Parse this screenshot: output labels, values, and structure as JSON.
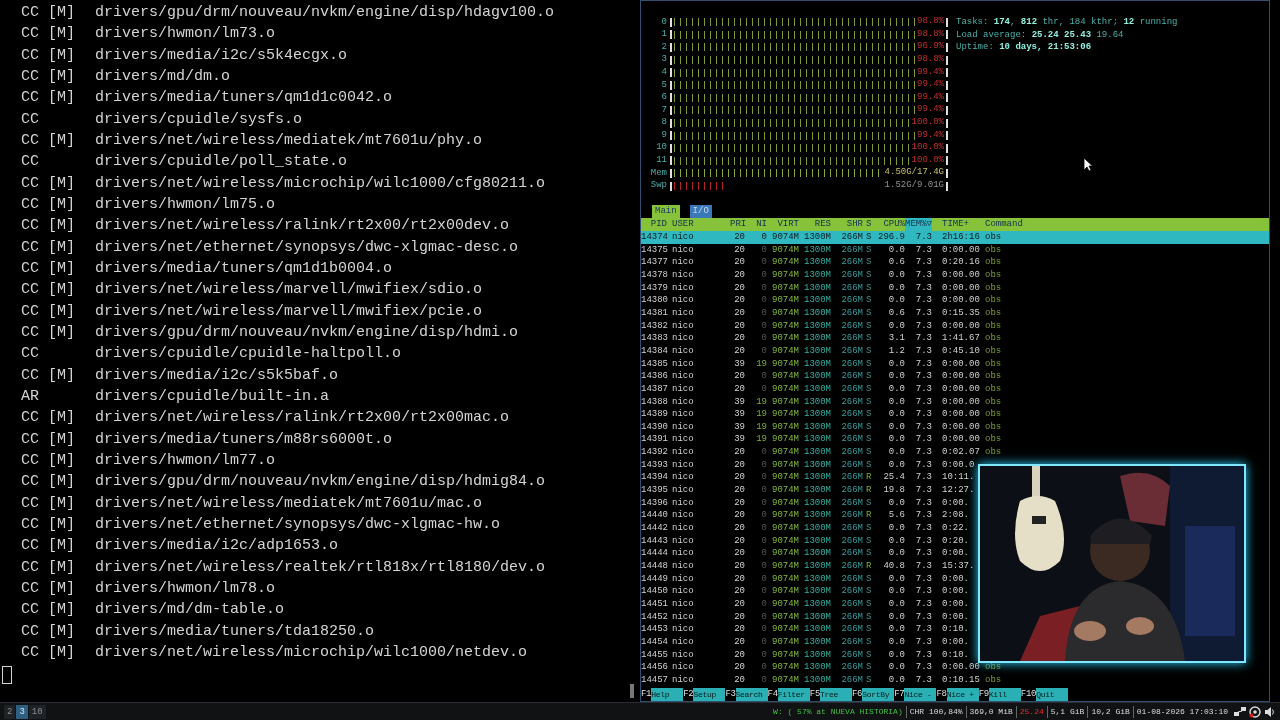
{
  "terminal": {
    "lines": [
      {
        "tag": "CC [M]",
        "path": "drivers/gpu/drm/nouveau/nvkm/engine/disp/hdagv100.o"
      },
      {
        "tag": "CC [M]",
        "path": "drivers/hwmon/lm73.o"
      },
      {
        "tag": "CC [M]",
        "path": "drivers/media/i2c/s5k4ecgx.o"
      },
      {
        "tag": "CC [M]",
        "path": "drivers/md/dm.o"
      },
      {
        "tag": "CC [M]",
        "path": "drivers/media/tuners/qm1d1c0042.o"
      },
      {
        "tag": "CC",
        "path": "drivers/cpuidle/sysfs.o"
      },
      {
        "tag": "CC [M]",
        "path": "drivers/net/wireless/mediatek/mt7601u/phy.o"
      },
      {
        "tag": "CC",
        "path": "drivers/cpuidle/poll_state.o"
      },
      {
        "tag": "CC [M]",
        "path": "drivers/net/wireless/microchip/wilc1000/cfg80211.o"
      },
      {
        "tag": "CC [M]",
        "path": "drivers/hwmon/lm75.o"
      },
      {
        "tag": "CC [M]",
        "path": "drivers/net/wireless/ralink/rt2x00/rt2x00dev.o"
      },
      {
        "tag": "CC [M]",
        "path": "drivers/net/ethernet/synopsys/dwc-xlgmac-desc.o"
      },
      {
        "tag": "CC [M]",
        "path": "drivers/media/tuners/qm1d1b0004.o"
      },
      {
        "tag": "CC [M]",
        "path": "drivers/net/wireless/marvell/mwifiex/sdio.o"
      },
      {
        "tag": "CC [M]",
        "path": "drivers/net/wireless/marvell/mwifiex/pcie.o"
      },
      {
        "tag": "CC [M]",
        "path": "drivers/gpu/drm/nouveau/nvkm/engine/disp/hdmi.o"
      },
      {
        "tag": "CC",
        "path": "drivers/cpuidle/cpuidle-haltpoll.o"
      },
      {
        "tag": "CC [M]",
        "path": "drivers/media/i2c/s5k5baf.o"
      },
      {
        "tag": "AR",
        "path": "drivers/cpuidle/built-in.a"
      },
      {
        "tag": "CC [M]",
        "path": "drivers/net/wireless/ralink/rt2x00/rt2x00mac.o"
      },
      {
        "tag": "CC [M]",
        "path": "drivers/media/tuners/m88rs6000t.o"
      },
      {
        "tag": "CC [M]",
        "path": "drivers/hwmon/lm77.o"
      },
      {
        "tag": "CC [M]",
        "path": "drivers/gpu/drm/nouveau/nvkm/engine/disp/hdmig84.o"
      },
      {
        "tag": "CC [M]",
        "path": "drivers/net/wireless/mediatek/mt7601u/mac.o"
      },
      {
        "tag": "CC [M]",
        "path": "drivers/net/ethernet/synopsys/dwc-xlgmac-hw.o"
      },
      {
        "tag": "CC [M]",
        "path": "drivers/media/i2c/adp1653.o"
      },
      {
        "tag": "CC [M]",
        "path": "drivers/net/wireless/realtek/rtl818x/rtl8180/dev.o"
      },
      {
        "tag": "CC [M]",
        "path": "drivers/hwmon/lm78.o"
      },
      {
        "tag": "CC [M]",
        "path": "drivers/md/dm-table.o"
      },
      {
        "tag": "CC [M]",
        "path": "drivers/media/tuners/tda18250.o"
      },
      {
        "tag": "CC [M]",
        "path": "drivers/net/wireless/microchip/wilc1000/netdev.o"
      }
    ]
  },
  "htop": {
    "cpu_meters": [
      {
        "label": "0",
        "level": 0.988,
        "percent": "98.8%"
      },
      {
        "label": "1",
        "level": 0.988,
        "percent": "98.8%"
      },
      {
        "label": "2",
        "level": 0.969,
        "percent": "96.9%"
      },
      {
        "label": "3",
        "level": 0.988,
        "percent": "98.8%"
      },
      {
        "label": "4",
        "level": 0.994,
        "percent": "99.4%"
      },
      {
        "label": "5",
        "level": 0.994,
        "percent": "99.4%"
      },
      {
        "label": "6",
        "level": 0.994,
        "percent": "99.4%"
      },
      {
        "label": "7",
        "level": 0.994,
        "percent": "99.4%"
      },
      {
        "label": "8",
        "level": 1,
        "percent": "100.0%"
      },
      {
        "label": "9",
        "level": 0.994,
        "percent": "99.4%"
      },
      {
        "label": "10",
        "level": 1,
        "percent": "100.0%"
      },
      {
        "label": "11",
        "level": 1,
        "percent": "100.0%"
      }
    ],
    "memory_meters": [
      {
        "label": "Mem",
        "kind": "mem",
        "level": 0.93,
        "reading": "4.50G/17.4G"
      },
      {
        "label": "Swp",
        "kind": "swap",
        "level": 0.18,
        "reading": "1.52G/9.01G"
      }
    ],
    "summary": [
      "Tasks: **174**, **812** thr, 184 kthr; **12** running",
      "Load average: **25.24** **25.43** 19.64",
      "Uptime: **10 days, 21:53:06**"
    ],
    "tabs": [
      {
        "label": "Main",
        "selected": true
      },
      {
        "label": "I/O",
        "selected": false
      }
    ],
    "columns": [
      {
        "label": "PID",
        "sorted": false
      },
      {
        "label": "USER",
        "sorted": false
      },
      {
        "label": "PRI",
        "sorted": false
      },
      {
        "label": "NI",
        "sorted": false
      },
      {
        "label": "VIRT",
        "sorted": false
      },
      {
        "label": "RES",
        "sorted": false
      },
      {
        "label": "SHR",
        "sorted": false
      },
      {
        "label": "S",
        "sorted": false
      },
      {
        "label": "CPU%",
        "sorted": false
      },
      {
        "label": "MEM%▽",
        "sorted": true
      },
      {
        "label": "TIME+",
        "sorted": false
      },
      {
        "label": "Command",
        "sorted": false
      }
    ],
    "rows": [
      {
        "pid": "14374",
        "user": "nico",
        "pri": "20",
        "ni": "0",
        "virt": "9074M",
        "res": "1300M",
        "shr": "266M",
        "s": "S",
        "cpu": "296.9",
        "mem": "7.3",
        "time": "2h16:16",
        "command": "obs",
        "selected": true,
        "niced": false,
        "running": false
      },
      {
        "pid": "14375",
        "user": "nico",
        "pri": "20",
        "ni": "0",
        "virt": "9074M",
        "res": "1300M",
        "shr": "266M",
        "s": "S",
        "cpu": "0.0",
        "mem": "7.3",
        "time": "0:00.00",
        "command": "obs",
        "selected": false,
        "niced": false,
        "running": false
      },
      {
        "pid": "14377",
        "user": "nico",
        "pri": "20",
        "ni": "0",
        "virt": "9074M",
        "res": "1300M",
        "shr": "266M",
        "s": "S",
        "cpu": "0.6",
        "mem": "7.3",
        "time": "0:20.16",
        "command": "obs",
        "selected": false,
        "niced": false,
        "running": false
      },
      {
        "pid": "14378",
        "user": "nico",
        "pri": "20",
        "ni": "0",
        "virt": "9074M",
        "res": "1300M",
        "shr": "266M",
        "s": "S",
        "cpu": "0.0",
        "mem": "7.3",
        "time": "0:00.00",
        "command": "obs",
        "selected": false,
        "niced": false,
        "running": false
      },
      {
        "pid": "14379",
        "user": "nico",
        "pri": "20",
        "ni": "0",
        "virt": "9074M",
        "res": "1300M",
        "shr": "266M",
        "s": "S",
        "cpu": "0.0",
        "mem": "7.3",
        "time": "0:00.00",
        "command": "obs",
        "selected": false,
        "niced": false,
        "running": false
      },
      {
        "pid": "14380",
        "user": "nico",
        "pri": "20",
        "ni": "0",
        "virt": "9074M",
        "res": "1300M",
        "shr": "266M",
        "s": "S",
        "cpu": "0.0",
        "mem": "7.3",
        "time": "0:00.00",
        "command": "obs",
        "selected": false,
        "niced": false,
        "running": false
      },
      {
        "pid": "14381",
        "user": "nico",
        "pri": "20",
        "ni": "0",
        "virt": "9074M",
        "res": "1300M",
        "shr": "266M",
        "s": "S",
        "cpu": "0.6",
        "mem": "7.3",
        "time": "0:15.35",
        "command": "obs",
        "selected": false,
        "niced": false,
        "running": false
      },
      {
        "pid": "14382",
        "user": "nico",
        "pri": "20",
        "ni": "0",
        "virt": "9074M",
        "res": "1300M",
        "shr": "266M",
        "s": "S",
        "cpu": "0.0",
        "mem": "7.3",
        "time": "0:00.00",
        "command": "obs",
        "selected": false,
        "niced": false,
        "running": false
      },
      {
        "pid": "14383",
        "user": "nico",
        "pri": "20",
        "ni": "0",
        "virt": "9074M",
        "res": "1300M",
        "shr": "266M",
        "s": "S",
        "cpu": "3.1",
        "mem": "7.3",
        "time": "1:41.67",
        "command": "obs",
        "selected": false,
        "niced": false,
        "running": false
      },
      {
        "pid": "14384",
        "user": "nico",
        "pri": "20",
        "ni": "0",
        "virt": "9074M",
        "res": "1300M",
        "shr": "266M",
        "s": "S",
        "cpu": "1.2",
        "mem": "7.3",
        "time": "0:45.10",
        "command": "obs",
        "selected": false,
        "niced": false,
        "running": false
      },
      {
        "pid": "14385",
        "user": "nico",
        "pri": "39",
        "ni": "19",
        "virt": "9074M",
        "res": "1300M",
        "shr": "266M",
        "s": "S",
        "cpu": "0.0",
        "mem": "7.3",
        "time": "0:00.00",
        "command": "obs",
        "selected": false,
        "niced": true,
        "running": false
      },
      {
        "pid": "14386",
        "user": "nico",
        "pri": "20",
        "ni": "0",
        "virt": "9074M",
        "res": "1300M",
        "shr": "266M",
        "s": "S",
        "cpu": "0.0",
        "mem": "7.3",
        "time": "0:00.00",
        "command": "obs",
        "selected": false,
        "niced": false,
        "running": false
      },
      {
        "pid": "14387",
        "user": "nico",
        "pri": "20",
        "ni": "0",
        "virt": "9074M",
        "res": "1300M",
        "shr": "266M",
        "s": "S",
        "cpu": "0.0",
        "mem": "7.3",
        "time": "0:00.00",
        "command": "obs",
        "selected": false,
        "niced": false,
        "running": false
      },
      {
        "pid": "14388",
        "user": "nico",
        "pri": "39",
        "ni": "19",
        "virt": "9074M",
        "res": "1300M",
        "shr": "266M",
        "s": "S",
        "cpu": "0.0",
        "mem": "7.3",
        "time": "0:00.00",
        "command": "obs",
        "selected": false,
        "niced": true,
        "running": false
      },
      {
        "pid": "14389",
        "user": "nico",
        "pri": "39",
        "ni": "19",
        "virt": "9074M",
        "res": "1300M",
        "shr": "266M",
        "s": "S",
        "cpu": "0.0",
        "mem": "7.3",
        "time": "0:00.00",
        "command": "obs",
        "selected": false,
        "niced": true,
        "running": false
      },
      {
        "pid": "14390",
        "user": "nico",
        "pri": "39",
        "ni": "19",
        "virt": "9074M",
        "res": "1300M",
        "shr": "266M",
        "s": "S",
        "cpu": "0.0",
        "mem": "7.3",
        "time": "0:00.00",
        "command": "obs",
        "selected": false,
        "niced": true,
        "running": false
      },
      {
        "pid": "14391",
        "user": "nico",
        "pri": "39",
        "ni": "19",
        "virt": "9074M",
        "res": "1300M",
        "shr": "266M",
        "s": "S",
        "cpu": "0.0",
        "mem": "7.3",
        "time": "0:00.00",
        "command": "obs",
        "selected": false,
        "niced": true,
        "running": false
      },
      {
        "pid": "14392",
        "user": "nico",
        "pri": "20",
        "ni": "0",
        "virt": "9074M",
        "res": "1300M",
        "shr": "266M",
        "s": "S",
        "cpu": "0.0",
        "mem": "7.3",
        "time": "0:02.07",
        "command": "obs",
        "selected": false,
        "niced": false,
        "running": false
      },
      {
        "pid": "14393",
        "user": "nico",
        "pri": "20",
        "ni": "0",
        "virt": "9074M",
        "res": "1300M",
        "shr": "266M",
        "s": "S",
        "cpu": "0.0",
        "mem": "7.3",
        "time": "0:00.0",
        "selected": false,
        "niced": false,
        "running": false
      },
      {
        "pid": "14394",
        "user": "nico",
        "pri": "20",
        "ni": "0",
        "virt": "9074M",
        "res": "1300M",
        "shr": "266M",
        "s": "R",
        "cpu": "25.4",
        "mem": "7.3",
        "time": "10:11.",
        "selected": false,
        "niced": false,
        "running": true
      },
      {
        "pid": "14395",
        "user": "nico",
        "pri": "20",
        "ni": "0",
        "virt": "9074M",
        "res": "1300M",
        "shr": "266M",
        "s": "R",
        "cpu": "19.8",
        "mem": "7.3",
        "time": "12:27.",
        "selected": false,
        "niced": false,
        "running": true
      },
      {
        "pid": "14396",
        "user": "nico",
        "pri": "20",
        "ni": "0",
        "virt": "9074M",
        "res": "1300M",
        "shr": "266M",
        "s": "S",
        "cpu": "0.0",
        "mem": "7.3",
        "time": "0:00.",
        "selected": false,
        "niced": false,
        "running": false
      },
      {
        "pid": "14440",
        "user": "nico",
        "pri": "20",
        "ni": "0",
        "virt": "9074M",
        "res": "1300M",
        "shr": "266M",
        "s": "R",
        "cpu": "5.6",
        "mem": "7.3",
        "time": "2:08.",
        "selected": false,
        "niced": false,
        "running": true
      },
      {
        "pid": "14442",
        "user": "nico",
        "pri": "20",
        "ni": "0",
        "virt": "9074M",
        "res": "1300M",
        "shr": "266M",
        "s": "S",
        "cpu": "0.0",
        "mem": "7.3",
        "time": "0:22.",
        "selected": false,
        "niced": false,
        "running": false
      },
      {
        "pid": "14443",
        "user": "nico",
        "pri": "20",
        "ni": "0",
        "virt": "9074M",
        "res": "1300M",
        "shr": "266M",
        "s": "S",
        "cpu": "0.0",
        "mem": "7.3",
        "time": "0:20.",
        "selected": false,
        "niced": false,
        "running": false
      },
      {
        "pid": "14444",
        "user": "nico",
        "pri": "20",
        "ni": "0",
        "virt": "9074M",
        "res": "1300M",
        "shr": "266M",
        "s": "S",
        "cpu": "0.0",
        "mem": "7.3",
        "time": "0:00.",
        "selected": false,
        "niced": false,
        "running": false
      },
      {
        "pid": "14448",
        "user": "nico",
        "pri": "20",
        "ni": "0",
        "virt": "9074M",
        "res": "1300M",
        "shr": "266M",
        "s": "R",
        "cpu": "40.8",
        "mem": "7.3",
        "time": "15:37.",
        "selected": false,
        "niced": false,
        "running": true
      },
      {
        "pid": "14449",
        "user": "nico",
        "pri": "20",
        "ni": "0",
        "virt": "9074M",
        "res": "1300M",
        "shr": "266M",
        "s": "S",
        "cpu": "0.0",
        "mem": "7.3",
        "time": "0:00.",
        "selected": false,
        "niced": false,
        "running": false
      },
      {
        "pid": "14450",
        "user": "nico",
        "pri": "20",
        "ni": "0",
        "virt": "9074M",
        "res": "1300M",
        "shr": "266M",
        "s": "S",
        "cpu": "0.0",
        "mem": "7.3",
        "time": "0:00.",
        "selected": false,
        "niced": false,
        "running": false
      },
      {
        "pid": "14451",
        "user": "nico",
        "pri": "20",
        "ni": "0",
        "virt": "9074M",
        "res": "1300M",
        "shr": "266M",
        "s": "S",
        "cpu": "0.0",
        "mem": "7.3",
        "time": "0:00.",
        "selected": false,
        "niced": false,
        "running": false
      },
      {
        "pid": "14452",
        "user": "nico",
        "pri": "20",
        "ni": "0",
        "virt": "9074M",
        "res": "1300M",
        "shr": "266M",
        "s": "S",
        "cpu": "0.0",
        "mem": "7.3",
        "time": "0:00.",
        "selected": false,
        "niced": false,
        "running": false
      },
      {
        "pid": "14453",
        "user": "nico",
        "pri": "20",
        "ni": "0",
        "virt": "9074M",
        "res": "1300M",
        "shr": "266M",
        "s": "S",
        "cpu": "0.0",
        "mem": "7.3",
        "time": "0:10.",
        "selected": false,
        "niced": false,
        "running": false
      },
      {
        "pid": "14454",
        "user": "nico",
        "pri": "20",
        "ni": "0",
        "virt": "9074M",
        "res": "1300M",
        "shr": "266M",
        "s": "S",
        "cpu": "0.0",
        "mem": "7.3",
        "time": "0:00.",
        "selected": false,
        "niced": false,
        "running": false
      },
      {
        "pid": "14455",
        "user": "nico",
        "pri": "20",
        "ni": "0",
        "virt": "9074M",
        "res": "1300M",
        "shr": "266M",
        "s": "S",
        "cpu": "0.0",
        "mem": "7.3",
        "time": "0:10.",
        "selected": false,
        "niced": false,
        "running": false
      },
      {
        "pid": "14456",
        "user": "nico",
        "pri": "20",
        "ni": "0",
        "virt": "9074M",
        "res": "1300M",
        "shr": "266M",
        "s": "S",
        "cpu": "0.0",
        "mem": "7.3",
        "time": "0:00.00",
        "command": "obs",
        "selected": false,
        "niced": false,
        "running": false
      },
      {
        "pid": "14457",
        "user": "nico",
        "pri": "20",
        "ni": "0",
        "virt": "9074M",
        "res": "1300M",
        "shr": "266M",
        "s": "S",
        "cpu": "0.0",
        "mem": "7.3",
        "time": "0:10.15",
        "command": "obs",
        "selected": false,
        "niced": false,
        "running": false
      }
    ],
    "function_keys": [
      {
        "key": "F1",
        "label": "Help"
      },
      {
        "key": "F2",
        "label": "Setup"
      },
      {
        "key": "F3",
        "label": "Search"
      },
      {
        "key": "F4",
        "label": "Filter"
      },
      {
        "key": "F5",
        "label": "Tree"
      },
      {
        "key": "F6",
        "label": "SortBy"
      },
      {
        "key": "F7",
        "label": "Nice -"
      },
      {
        "key": "F8",
        "label": "Nice +"
      },
      {
        "key": "F9",
        "label": "Kill"
      },
      {
        "key": "F10",
        "label": "Quit"
      }
    ]
  },
  "taskbar": {
    "workspaces": [
      {
        "label": "2",
        "selected": false
      },
      {
        "label": "3",
        "selected": true
      },
      {
        "label": "10",
        "selected": false
      }
    ],
    "status": [
      {
        "text": "W: ( 57% at NUEVA HISTORIA)",
        "kind": "good"
      },
      {
        "text": "CHR 100,84%",
        "kind": "plain"
      },
      {
        "text": "369,0 MiB",
        "kind": "plain"
      },
      {
        "text": "25.24",
        "kind": "alert"
      },
      {
        "text": "5,1 GiB",
        "kind": "plain"
      },
      {
        "text": "10,2 GiB",
        "kind": "plain"
      },
      {
        "text": "01-08-2026 17:03:10",
        "kind": "plain"
      }
    ]
  }
}
